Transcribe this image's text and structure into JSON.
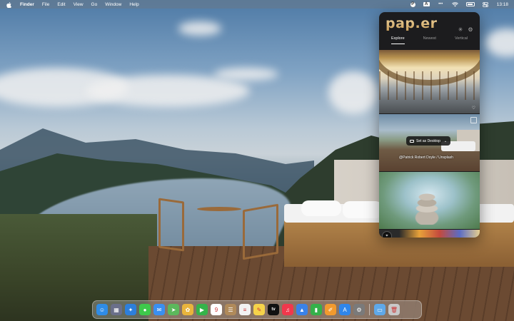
{
  "menubar": {
    "apple_icon": "apple-logo-icon",
    "app_name": "Finder",
    "menus": [
      "File",
      "Edit",
      "View",
      "Go",
      "Window",
      "Help"
    ],
    "status_icons": [
      "paper-status-icon",
      "input-source-icon",
      "dots-icon",
      "wifi-icon",
      "battery-icon",
      "control-center-icon"
    ],
    "time": "13:18",
    "paper_glyph": "P",
    "input_glyph": "A"
  },
  "popover": {
    "logo": "pap.er",
    "tabs": [
      "Explore",
      "Newest",
      "Vertical"
    ],
    "active_tab": "Explore",
    "overlay_button_label": "Set as Desktop",
    "photo_credit": "@Patrick Robert Doyle / Unsplash",
    "colors": {
      "background": "#1c1c1e",
      "logo": "#e7c88a"
    }
  },
  "dock": {
    "items": [
      {
        "name": "finder-icon",
        "glyph": "☺",
        "color": "#2f8ce6"
      },
      {
        "name": "launchpad-icon",
        "glyph": "▦",
        "color": "#6a6f8a"
      },
      {
        "name": "safari-icon",
        "glyph": "✦",
        "color": "#2d7fdb"
      },
      {
        "name": "messages-icon",
        "glyph": "●",
        "color": "#3ec94b"
      },
      {
        "name": "mail-icon",
        "glyph": "✉",
        "color": "#3a8ff0"
      },
      {
        "name": "maps-icon",
        "glyph": "➤",
        "color": "#5cb85c"
      },
      {
        "name": "photos-icon",
        "glyph": "✿",
        "color": "#e9b43c"
      },
      {
        "name": "facetime-icon",
        "glyph": "▶",
        "color": "#35b34a"
      },
      {
        "name": "calendar-icon",
        "glyph": "9",
        "color": "#ffffff"
      },
      {
        "name": "contacts-icon",
        "glyph": "☰",
        "color": "#b08a5a"
      },
      {
        "name": "reminders-icon",
        "glyph": "≡",
        "color": "#f2f2f2"
      },
      {
        "name": "notes-icon",
        "glyph": "✎",
        "color": "#f5d34a"
      },
      {
        "name": "appletv-icon",
        "glyph": "tv",
        "color": "#111111"
      },
      {
        "name": "music-icon",
        "glyph": "♫",
        "color": "#f0384c"
      },
      {
        "name": "keynote-icon",
        "glyph": "▲",
        "color": "#3a82e8"
      },
      {
        "name": "numbers-icon",
        "glyph": "▮",
        "color": "#35b14a"
      },
      {
        "name": "pages-icon",
        "glyph": "✐",
        "color": "#f29a2e"
      },
      {
        "name": "appstore-icon",
        "glyph": "A",
        "color": "#2f86ea"
      },
      {
        "name": "system-settings-icon",
        "glyph": "⚙",
        "color": "#7a7a7a"
      }
    ],
    "trailing": [
      {
        "name": "downloads-folder-icon",
        "glyph": "▭",
        "color": "#5fa8e8"
      },
      {
        "name": "trash-icon",
        "glyph": "🗑",
        "color": "#c8c8c8"
      }
    ]
  }
}
